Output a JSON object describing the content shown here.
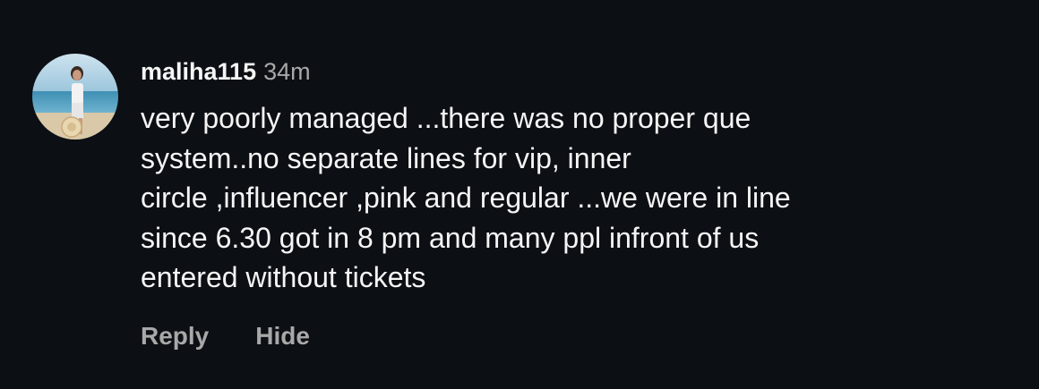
{
  "comment": {
    "username": "maliha115",
    "time": "34m",
    "text_lines": [
      "very poorly managed ...there was no proper que",
      "system..no separate lines for vip, inner",
      "circle ,influencer ,pink and regular ...we were in line",
      "since 6.30 got in 8 pm and many ppl infront of us",
      "entered without tickets"
    ],
    "actions": {
      "reply": "Reply",
      "hide": "Hide"
    },
    "avatar_icon": "user-avatar-photo"
  },
  "colors": {
    "background": "#0c0f14",
    "primary_text": "#f5f5f5",
    "secondary_text": "#a8a8a8"
  }
}
